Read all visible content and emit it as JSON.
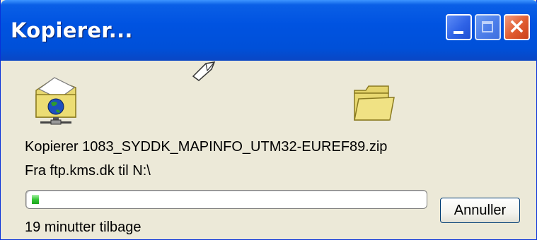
{
  "window": {
    "title": "Kopierer...",
    "buttons": {
      "minimize": "minimize-icon",
      "maximize": "maximize-icon",
      "close": "close-icon"
    }
  },
  "animation": {
    "source_icon": "network-folder-icon",
    "flying_item_icon": "flying-paper-icon",
    "destination_icon": "folder-icon"
  },
  "status": {
    "copying_line": "Kopierer 1083_SYDDK_MAPINFO_UTM32-EUREF89.zip",
    "from_to_line": "Fra ftp.kms.dk til N:\\",
    "time_remaining": "19 minutter tilbage"
  },
  "progress": {
    "fraction": 0.01
  },
  "cancel_label": "Annuller",
  "colors": {
    "titlebar": "#0053e1",
    "window_bg": "#ece9d8",
    "progress_fill": "#36c836"
  }
}
